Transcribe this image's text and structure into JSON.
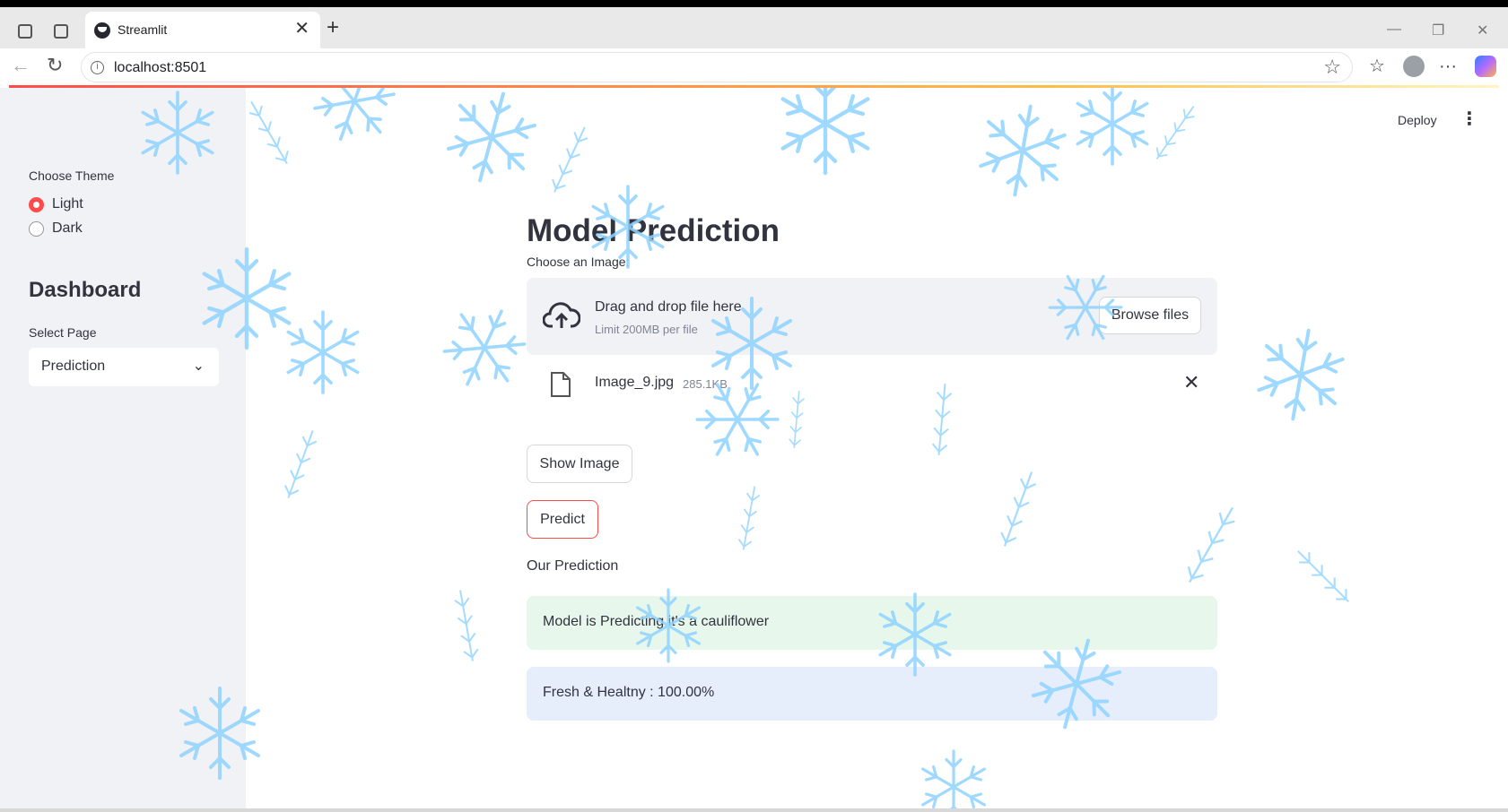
{
  "browser": {
    "tab_title": "Streamlit",
    "url": "localhost:8501"
  },
  "header": {
    "deploy_label": "Deploy"
  },
  "sidebar": {
    "theme_label": "Choose Theme",
    "theme_options": [
      "Light",
      "Dark"
    ],
    "theme_selected": "Light",
    "heading": "Dashboard",
    "page_label": "Select Page",
    "page_selected": "Prediction"
  },
  "main": {
    "title": "Model Prediction",
    "uploader_label": "Choose an Image:",
    "dropzone_text": "Drag and drop file here",
    "dropzone_limit": "Limit 200MB per file",
    "browse_label": "Browse files",
    "file_name": "Image_9.jpg",
    "file_size": "285.1KB",
    "show_image_label": "Show Image",
    "predict_label": "Predict",
    "prediction_heading": "Our Prediction",
    "success_text": "Model is Predicting it's a cauliflower",
    "info_text": "Fresh & Healtny : 100.00%"
  },
  "colors": {
    "accent": "#ff4b4b",
    "sidebar_bg": "#f0f2f6",
    "success_bg": "#e8f7ec",
    "info_bg": "#e6eefb",
    "snowflake": "#8fd3ff"
  }
}
